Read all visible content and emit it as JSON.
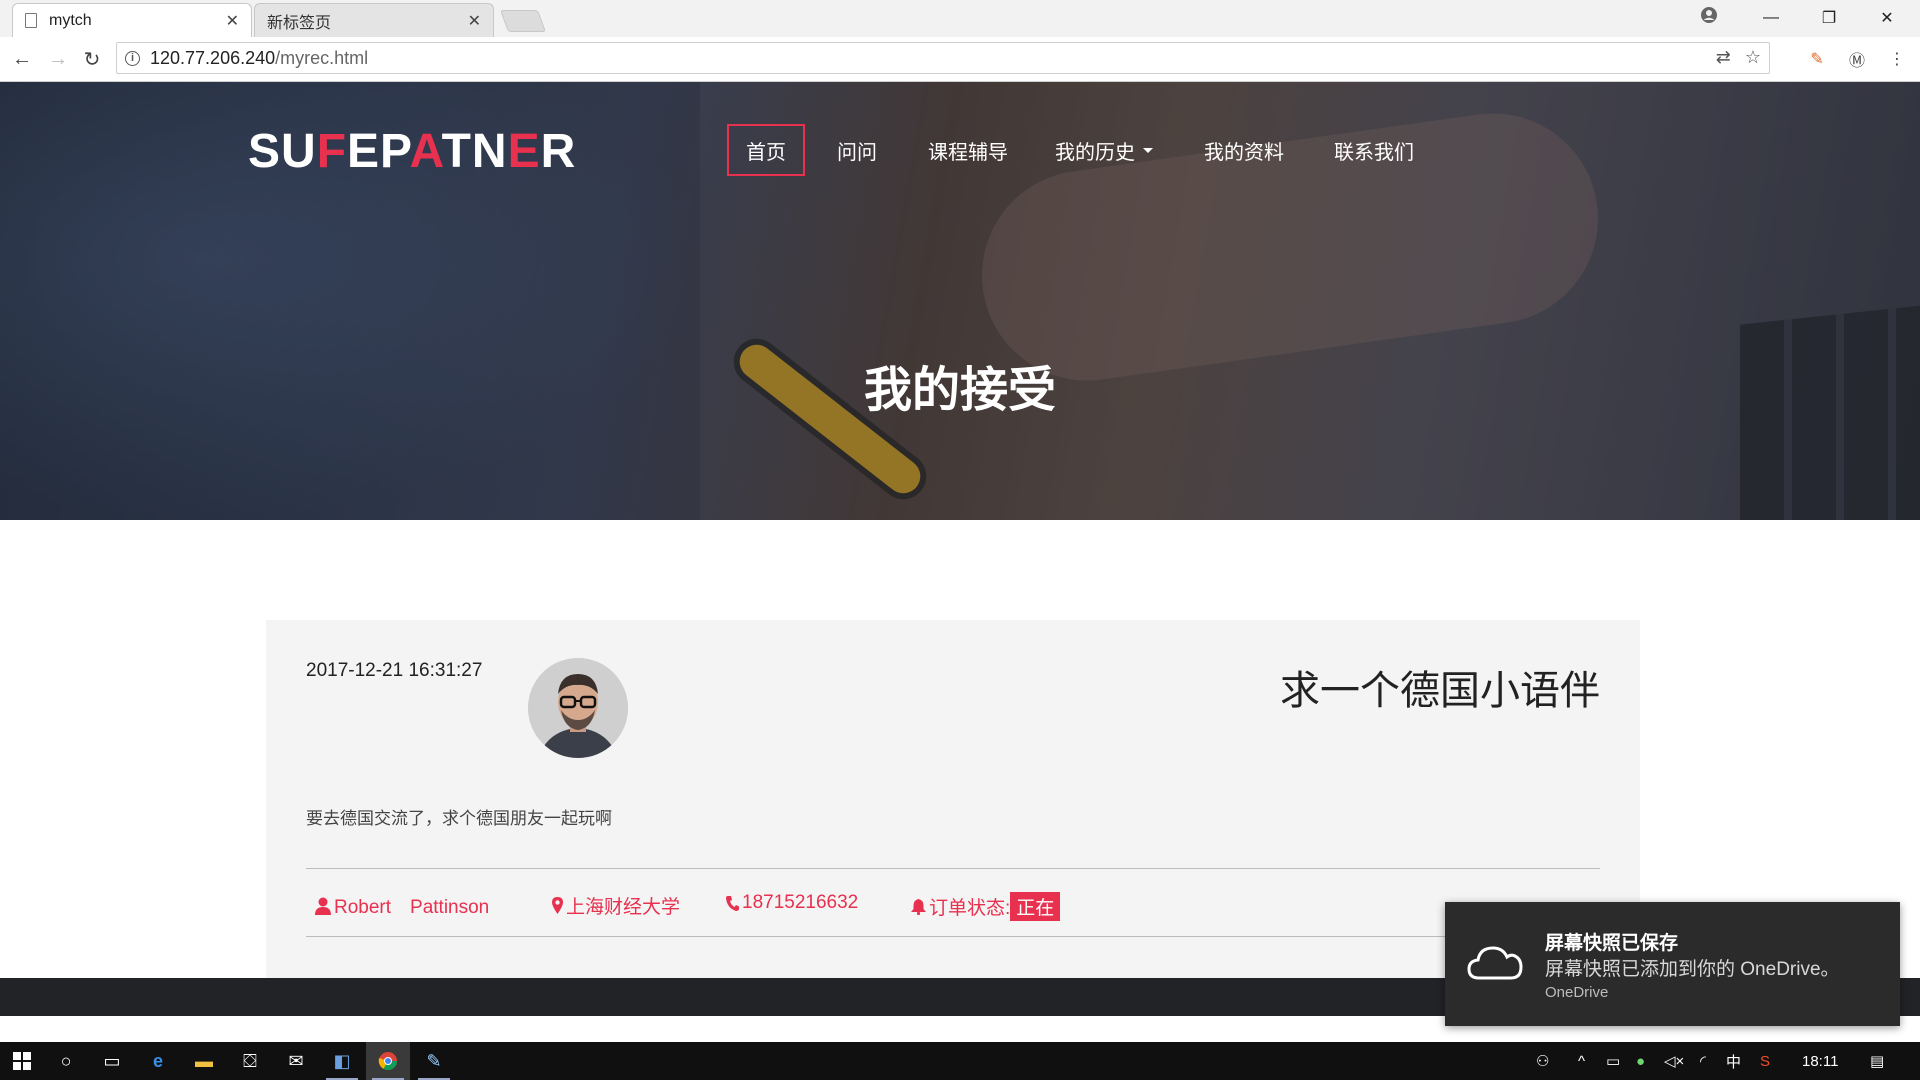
{
  "browser": {
    "tabs": [
      {
        "title": "mytch",
        "active": true
      },
      {
        "title": "新标签页",
        "active": false
      }
    ],
    "url_host": "120.77.206.240",
    "url_path": "/myrec.html"
  },
  "site": {
    "logo_parts": [
      {
        "text": "SU",
        "accent": false
      },
      {
        "text": "F",
        "accent": true
      },
      {
        "text": "EP",
        "accent": false
      },
      {
        "text": "A",
        "accent": true
      },
      {
        "text": "TN",
        "accent": false
      },
      {
        "text": "E",
        "accent": true
      },
      {
        "text": "R",
        "accent": false
      }
    ],
    "nav": [
      {
        "label": "首页",
        "active": true
      },
      {
        "label": "问问",
        "active": false
      },
      {
        "label": "课程辅导",
        "active": false
      },
      {
        "label": "我的历史",
        "active": false,
        "dropdown": true
      },
      {
        "label": "我的资料",
        "active": false
      },
      {
        "label": "联系我们",
        "active": false
      }
    ],
    "hero_title": "我的接受"
  },
  "card": {
    "datetime": "2017-12-21 16:31:27",
    "heading": "求一个德国小语伴",
    "description": "要去德国交流了，求个德国朋友一起玩啊",
    "name": "Robert　Pattinson",
    "location": "上海财经大学",
    "phone": "18715216632",
    "status_label": "订单状态:",
    "status_value": "正在"
  },
  "toast": {
    "title": "屏幕快照已保存",
    "body": "屏幕快照已添加到你的 OneDrive。",
    "source": "OneDrive"
  },
  "taskbar": {
    "ime": "中",
    "time": "18:11"
  },
  "colors": {
    "accent": "#e8304f",
    "taskbar": "#101010",
    "toast_bg": "#2b2b2b"
  }
}
